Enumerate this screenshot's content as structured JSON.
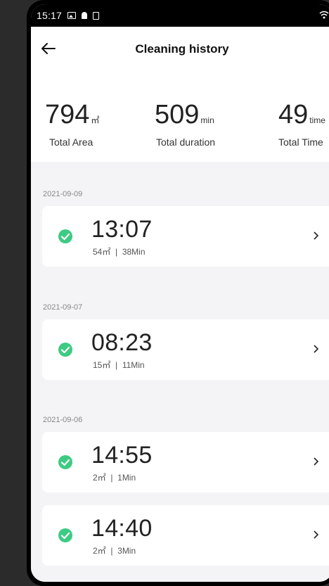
{
  "status_bar": {
    "time": "15:17"
  },
  "header": {
    "title": "Cleaning history"
  },
  "stats": [
    {
      "value": "794",
      "unit": "㎡",
      "label": "Total Area"
    },
    {
      "value": "509",
      "unit": "min",
      "label": "Total duration"
    },
    {
      "value": "49",
      "unit": "time",
      "label": "Total Time"
    }
  ],
  "history": [
    {
      "date": "2021-09-09",
      "time": "13:07",
      "area": "54㎡",
      "duration": "38Min"
    },
    {
      "date": "2021-09-07",
      "time": "08:23",
      "area": "15㎡",
      "duration": "11Min"
    },
    {
      "date": "2021-09-06",
      "time": "14:55",
      "area": "2㎡",
      "duration": "1Min"
    },
    {
      "date": "",
      "time": "14:40",
      "area": "2㎡",
      "duration": "3Min"
    }
  ],
  "colors": {
    "accent": "#3dcb84",
    "background": "#f4f4f6"
  },
  "icons": {
    "back": "arrow-left-icon",
    "check": "check-circle-icon",
    "chevron": "chevron-right-icon"
  }
}
